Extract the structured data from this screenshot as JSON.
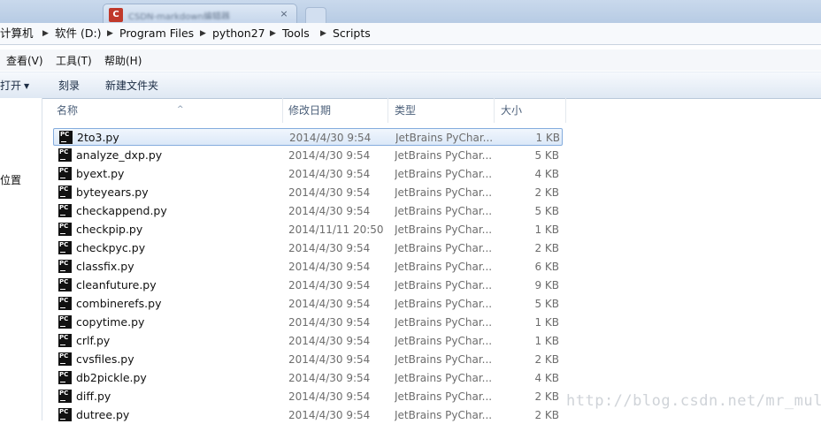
{
  "titlebar": {
    "tab_text": "CSDN-markdown编辑器",
    "tab_close": "×"
  },
  "breadcrumb": {
    "items": [
      "计算机",
      "软件 (D:)",
      "Program Files",
      "python27",
      "Tools",
      "Scripts"
    ],
    "separator": "▶"
  },
  "menubar": {
    "items": [
      "查看(V)",
      "工具(T)",
      "帮助(H)"
    ]
  },
  "commandbar": {
    "open_label": "打开",
    "open_arrow": "▼",
    "burn_label": "刻录",
    "new_folder_label": "新建文件夹"
  },
  "navpane": {
    "visible_label": "位置"
  },
  "columns": {
    "name": "名称",
    "date": "修改日期",
    "type": "类型",
    "size": "大小",
    "sort_indicator": "^"
  },
  "icon_text": "PC",
  "files": [
    {
      "name": "2to3.py",
      "date": "2014/4/30 9:54",
      "type": "JetBrains PyChar...",
      "size": "1 KB",
      "selected": true
    },
    {
      "name": "analyze_dxp.py",
      "date": "2014/4/30 9:54",
      "type": "JetBrains PyChar...",
      "size": "5 KB"
    },
    {
      "name": "byext.py",
      "date": "2014/4/30 9:54",
      "type": "JetBrains PyChar...",
      "size": "4 KB"
    },
    {
      "name": "byteyears.py",
      "date": "2014/4/30 9:54",
      "type": "JetBrains PyChar...",
      "size": "2 KB"
    },
    {
      "name": "checkappend.py",
      "date": "2014/4/30 9:54",
      "type": "JetBrains PyChar...",
      "size": "5 KB"
    },
    {
      "name": "checkpip.py",
      "date": "2014/11/11 20:50",
      "type": "JetBrains PyChar...",
      "size": "1 KB"
    },
    {
      "name": "checkpyc.py",
      "date": "2014/4/30 9:54",
      "type": "JetBrains PyChar...",
      "size": "2 KB"
    },
    {
      "name": "classfix.py",
      "date": "2014/4/30 9:54",
      "type": "JetBrains PyChar...",
      "size": "6 KB"
    },
    {
      "name": "cleanfuture.py",
      "date": "2014/4/30 9:54",
      "type": "JetBrains PyChar...",
      "size": "9 KB"
    },
    {
      "name": "combinerefs.py",
      "date": "2014/4/30 9:54",
      "type": "JetBrains PyChar...",
      "size": "5 KB"
    },
    {
      "name": "copytime.py",
      "date": "2014/4/30 9:54",
      "type": "JetBrains PyChar...",
      "size": "1 KB"
    },
    {
      "name": "crlf.py",
      "date": "2014/4/30 9:54",
      "type": "JetBrains PyChar...",
      "size": "1 KB"
    },
    {
      "name": "cvsfiles.py",
      "date": "2014/4/30 9:54",
      "type": "JetBrains PyChar...",
      "size": "2 KB"
    },
    {
      "name": "db2pickle.py",
      "date": "2014/4/30 9:54",
      "type": "JetBrains PyChar...",
      "size": "4 KB"
    },
    {
      "name": "diff.py",
      "date": "2014/4/30 9:54",
      "type": "JetBrains PyChar...",
      "size": "2 KB"
    },
    {
      "name": "dutree.py",
      "date": "2014/4/30 9:54",
      "type": "JetBrains PyChar...",
      "size": "2 KB"
    }
  ],
  "watermark": "http://blog.csdn.net/mr_muli",
  "colors": {
    "selection_border": "#84acdd",
    "selection_fill": "#dbe8f8",
    "header_text": "#4c607a"
  }
}
